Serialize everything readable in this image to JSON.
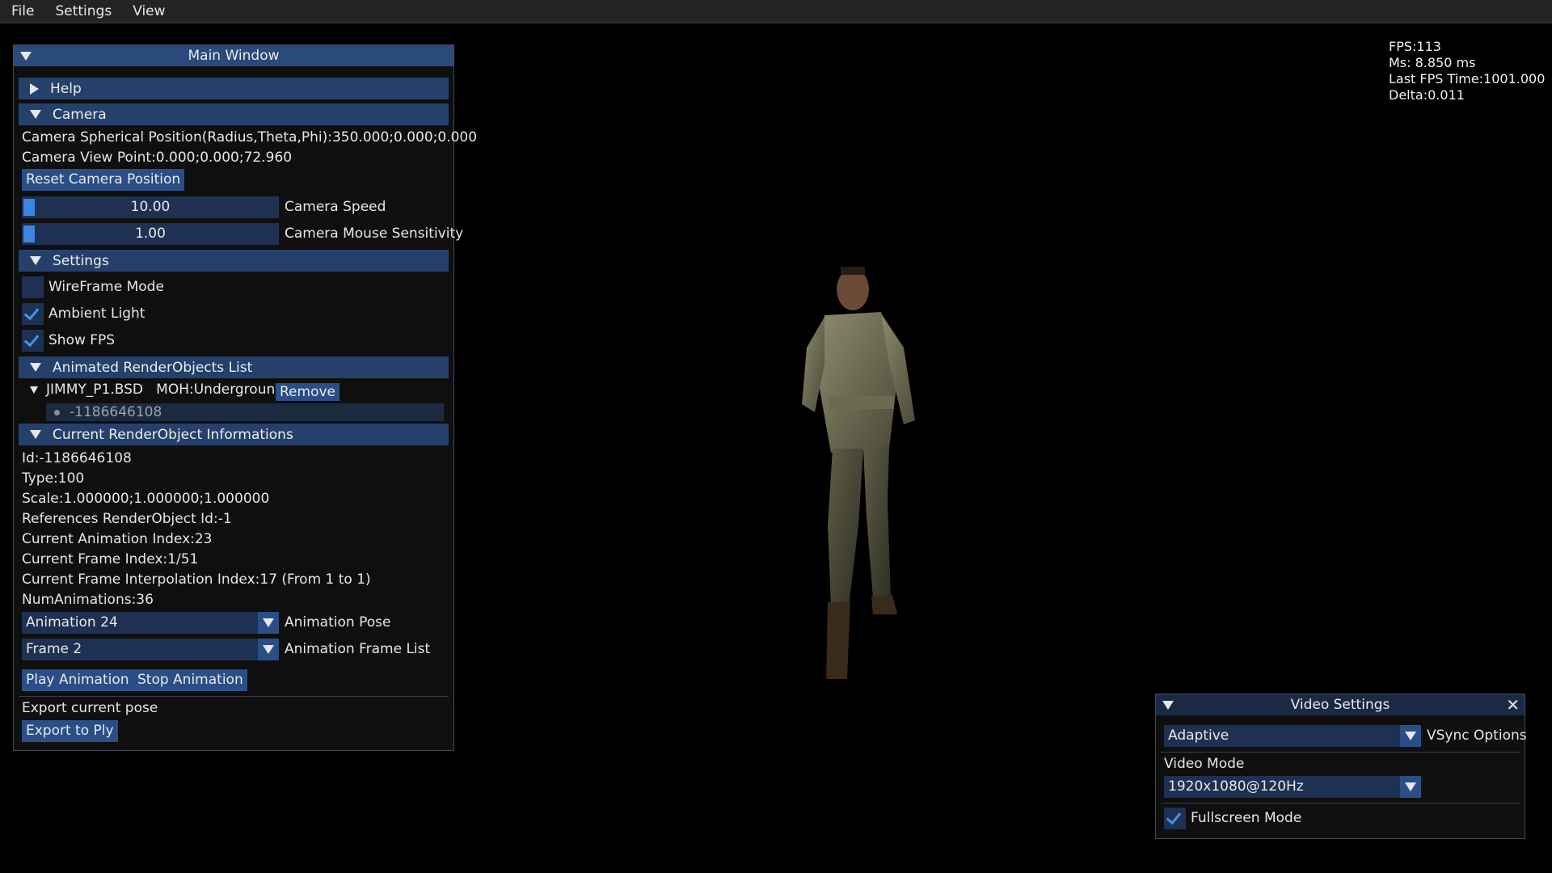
{
  "menubar": {
    "items": [
      "File",
      "Settings",
      "View"
    ]
  },
  "hud": {
    "fps": "FPS:113",
    "ms": "Ms: 8.850 ms",
    "last_fps_time": "Last FPS Time:1001.000",
    "delta": "Delta:0.011"
  },
  "main_window": {
    "title": "Main Window",
    "help_header": "Help",
    "camera_header": "Camera",
    "camera_spherical": "Camera Spherical Position(Radius,Theta,Phi):350.000;0.000;0.000",
    "camera_view_point": "Camera View Point:0.000;0.000;72.960",
    "reset_camera_button": "Reset Camera Position",
    "camera_speed_value": "10.00",
    "camera_speed_label": "Camera Speed",
    "mouse_sensitivity_value": "1.00",
    "mouse_sensitivity_label": "Camera Mouse Sensitivity",
    "settings_header": "Settings",
    "wireframe_label": "WireFrame Mode",
    "wireframe_checked": false,
    "ambient_label": "Ambient Light",
    "ambient_checked": true,
    "show_fps_label": "Show FPS",
    "show_fps_checked": true,
    "animated_list_header": "Animated RenderObjects List",
    "tree_node_label": "JIMMY_P1.BSD   MOH:Underground",
    "remove_button": "Remove",
    "tree_child_label": "-1186646108",
    "info_header": "Current RenderObject Informations",
    "info_lines": [
      "Id:-1186646108",
      "Type:100",
      "Scale:1.000000;1.000000;1.000000",
      "References RenderObject Id:-1",
      "Current Animation Index:23",
      "Current Frame Index:1/51",
      "Current Frame Interpolation Index:17 (From 1 to 1)",
      "NumAnimations:36"
    ],
    "animation_pose_value": "Animation 24",
    "animation_pose_label": "Animation Pose",
    "frame_list_value": "Frame 2",
    "frame_list_label": "Animation Frame List",
    "play_button": "Play Animation",
    "stop_button": "Stop Animation",
    "export_label": "Export current pose",
    "export_button": "Export to Ply"
  },
  "video_window": {
    "title": "Video Settings",
    "vsync_value": "Adaptive",
    "vsync_label": "VSync Options",
    "video_mode_label": "Video Mode",
    "video_mode_value": "1920x1080@120Hz",
    "fullscreen_label": "Fullscreen Mode",
    "fullscreen_checked": true
  },
  "colors": {
    "title_bar": "#294a7a",
    "header": "#25406b",
    "button": "#2a4f86",
    "frame_bg": "#1e3152",
    "check": "#4a90e8"
  }
}
